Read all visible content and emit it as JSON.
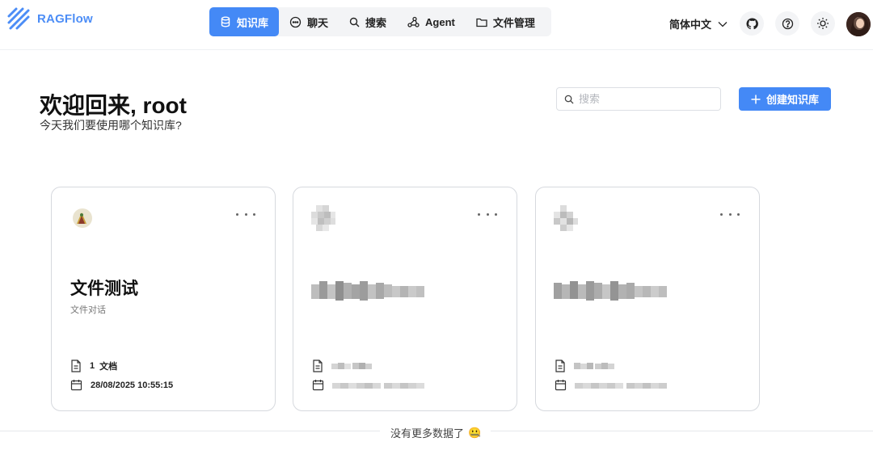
{
  "app": {
    "name": "RAGFlow"
  },
  "nav": {
    "items": [
      {
        "label": "知识库",
        "active": true,
        "icon": "database-icon"
      },
      {
        "label": "聊天",
        "active": false,
        "icon": "chat-icon"
      },
      {
        "label": "搜索",
        "active": false,
        "icon": "search-icon"
      },
      {
        "label": "Agent",
        "active": false,
        "icon": "agent-icon"
      },
      {
        "label": "文件管理",
        "active": false,
        "icon": "folder-icon"
      }
    ]
  },
  "header": {
    "language": "简体中文",
    "icons": [
      "github-icon",
      "help-icon",
      "theme-toggle-icon",
      "avatar"
    ]
  },
  "main": {
    "welcome": "欢迎回来, root",
    "subtitle": "今天我们要使用哪个知识库?",
    "search_placeholder": "搜索",
    "create_label": "创建知识库"
  },
  "cards": [
    {
      "title": "文件测试",
      "description": "文件对话",
      "docs_count": "1",
      "docs_label": "文档",
      "date": "28/08/2025 10:55:15"
    }
  ],
  "footer": {
    "text": "没有更多数据了",
    "emoji": "🤐"
  },
  "colors": {
    "primary": "#4489f6",
    "logo": "#4c8df6"
  }
}
